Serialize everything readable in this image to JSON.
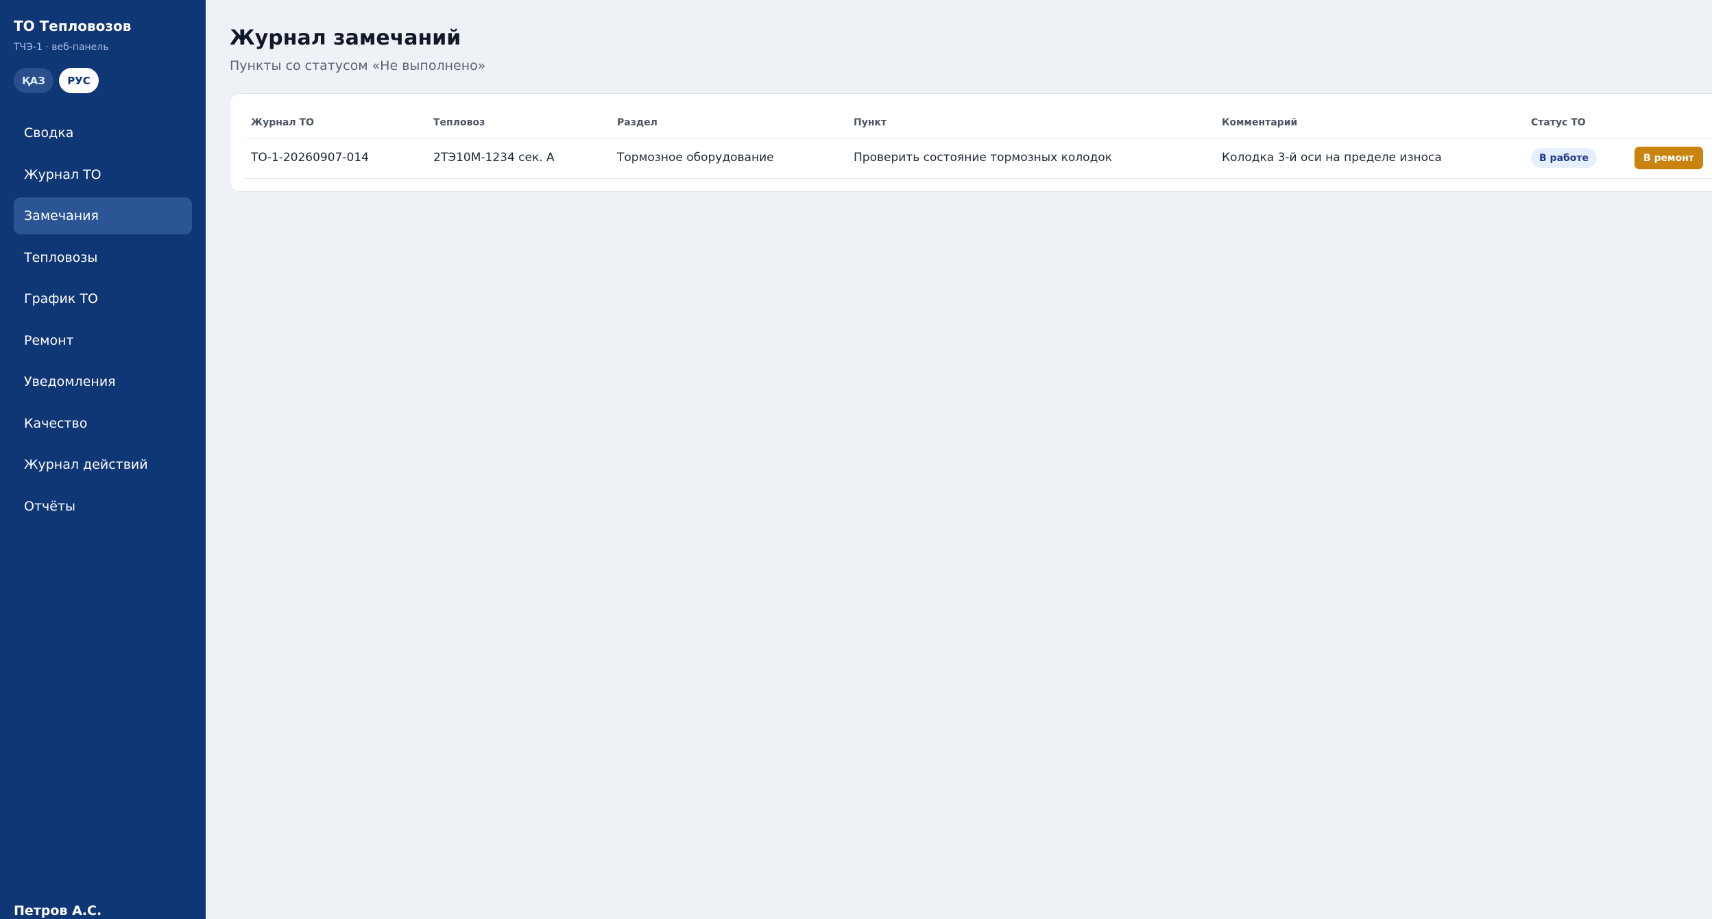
{
  "sidebar": {
    "title": "ТО Тепловозов",
    "subtitle": "ТЧЭ-1 · веб-панель",
    "languages": {
      "kaz": "ҚАЗ",
      "rus": "РУС"
    },
    "active_language": "РУС",
    "items": [
      {
        "label": "Сводка"
      },
      {
        "label": "Журнал ТО"
      },
      {
        "label": "Замечания"
      },
      {
        "label": "Тепловозы"
      },
      {
        "label": "График ТО"
      },
      {
        "label": "Ремонт"
      },
      {
        "label": "Уведомления"
      },
      {
        "label": "Качество"
      },
      {
        "label": "Журнал действий"
      },
      {
        "label": "Отчёты"
      }
    ],
    "active_item": "Замечания",
    "user": "Петров А.С."
  },
  "main": {
    "title": "Журнал замечаний",
    "subtitle": "Пункты со статусом «Не выполнено»",
    "table": {
      "headers": {
        "journal": "Журнал ТО",
        "locomotive": "Тепловоз",
        "section": "Раздел",
        "item": "Пункт",
        "comment": "Комментарий",
        "status": "Статус ТО"
      },
      "rows": [
        {
          "journal": "ТО-1-20260907-014",
          "locomotive": "2ТЭ10М-1234 сек. А",
          "section": "Тормозное оборудование",
          "item": "Проверить состояние тормозных колодок",
          "comment": "Колодка 3-й оси на пределе износа",
          "status": "В работе",
          "action_label": "В ремонт"
        }
      ]
    }
  },
  "colors": {
    "sidebar_bg": "#0f3675",
    "active_nav_bg": "#2c5595",
    "page_bg": "#eef1f5",
    "status_badge_bg": "#e6efff",
    "action_button_bg": "#c9830e"
  }
}
